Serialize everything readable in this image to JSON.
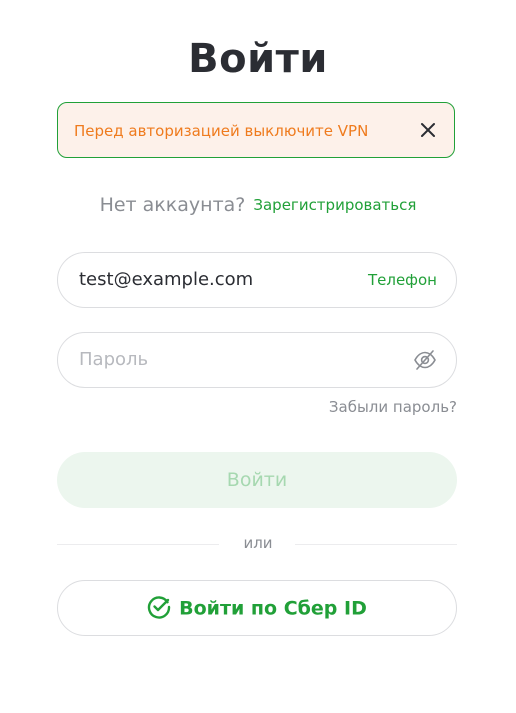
{
  "title": "Войти",
  "alert": {
    "text": "Перед авторизацией выключите VPN"
  },
  "signup": {
    "question": "Нет аккаунта?",
    "link": "Зарегистрироваться"
  },
  "email_field": {
    "value": "test@example.com",
    "switch_label": "Телефон"
  },
  "password_field": {
    "placeholder": "Пароль"
  },
  "forgot_label": "Забыли пароль?",
  "login_button": "Войти",
  "or_label": "или",
  "sber_button": "Войти по Сбер ID",
  "colors": {
    "accent": "#21a038",
    "warning": "#ef7b1e",
    "text": "#2b2d33",
    "muted": "#8a8d93"
  }
}
